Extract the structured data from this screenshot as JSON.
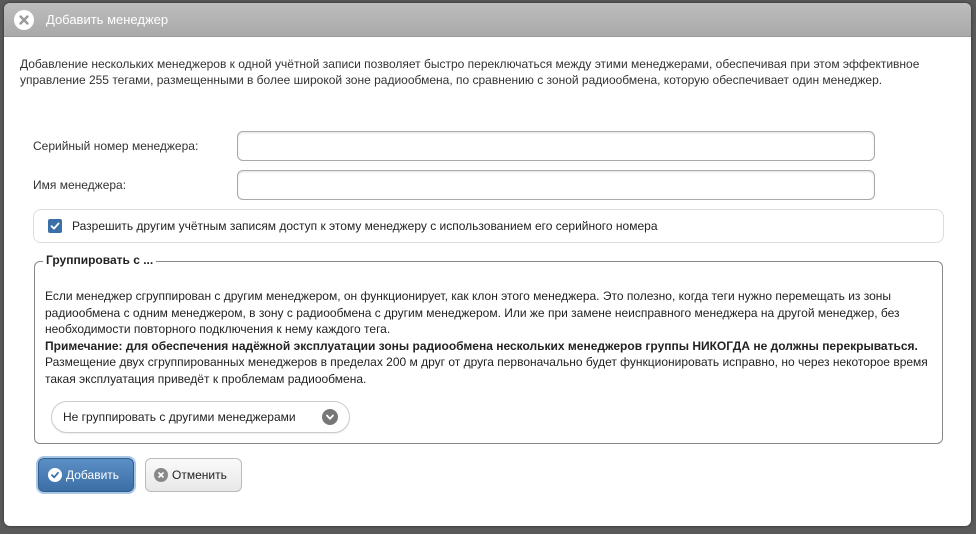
{
  "dialog": {
    "title": "Добавить менеджер",
    "description": "Добавление нескольких менеджеров к одной учётной записи позволяет быстро переключаться между этими менеджерами, обеспечивая при этом эффективное управление 255 тегами, размещенными в более широкой зоне радиообмена, по сравнению с зоной радиообмена, которую обеспечивает один менеджер."
  },
  "form": {
    "serial_label": "Серийный номер менеджера:",
    "serial_value": "",
    "name_label": "Имя менеджера:",
    "name_value": "",
    "allow_access_checked": true,
    "allow_access_label": "Разрешить другим учётным записям доступ к этому менеджеру с использованием его серийного номера"
  },
  "group": {
    "legend": "Группировать с ...",
    "text_1": "Если менеджер сгруппирован с другим менеджером, он функционирует, как клон этого менеджера. Это полезно, когда теги нужно перемещать из зоны радиообмена с одним менеджером, в зону с радиообмена с другим менеджером. Или же при замене неисправного менеджера на другой менеджер, без необходимости повторного подключения к нему каждого тега.",
    "note_bold": "Примечание: для обеспечения надёжной эксплуатации зоны радиообмена нескольких менеджеров группы НИКОГДА не должны перекрываться.",
    "note_rest": " Размещение двух сгруппированных менеджеров в пределах 200 м друг от друга первоначально будет функционировать исправно, но через некоторое время такая эксплуатация приведёт к проблемам радиообмена.",
    "select_value": "Не группировать с другими менеджерами"
  },
  "buttons": {
    "add_label": "Добавить",
    "cancel_label": "Отменить"
  },
  "icons": {
    "close": "close-circle-icon",
    "check": "checkmark-icon",
    "chevron": "chevron-down-icon",
    "cancel": "x-circle-icon"
  },
  "colors": {
    "accent": "#3c6fa6",
    "titlebar": "#b3b3b3"
  }
}
